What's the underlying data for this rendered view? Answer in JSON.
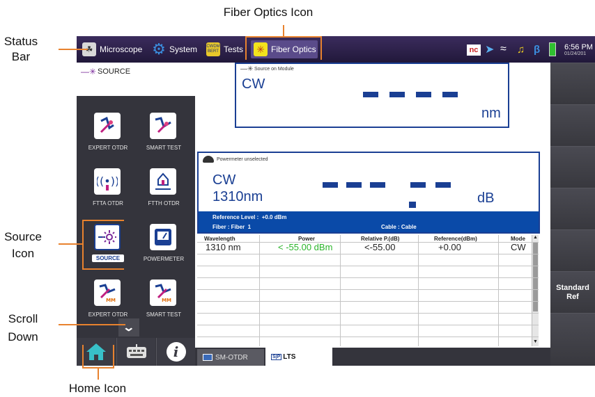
{
  "annotations": {
    "fiber_optics_icon": "Fiber Optics Icon",
    "status_bar_line1": "Status",
    "status_bar_line2": "Bar",
    "source_icon_line1": "Source",
    "source_icon_line2": "Icon",
    "scroll_down_line1": "Scroll",
    "scroll_down_line2": "Down",
    "home_icon": "Home Icon"
  },
  "statusbar": {
    "tabs": [
      {
        "label": "Microscope",
        "icon": "microscope-icon",
        "color": "#cfcfcf"
      },
      {
        "label": "System",
        "icon": "gear-icon",
        "color": "#3b8fe0"
      },
      {
        "label": "Tests",
        "icon": "tests-icon",
        "color": "#e0c52a",
        "badge": "CWDM\nBERT"
      },
      {
        "label": "Fiber Optics",
        "icon": "fiber-optics-icon",
        "color": "#f0e020"
      }
    ],
    "time": "6:56 PM",
    "date": "01/24/201",
    "nc_label": "nc"
  },
  "left": {
    "source_title": "SOURCE",
    "apps": [
      {
        "label": "EXPERT OTDR",
        "icon": "expert-otdr-icon"
      },
      {
        "label": "SMART TEST",
        "icon": "smart-test-icon"
      },
      {
        "label": "FTTA OTDR",
        "icon": "ftta-otdr-icon"
      },
      {
        "label": "FTTH OTDR",
        "icon": "ftth-otdr-icon"
      },
      {
        "label": "SOURCE",
        "icon": "source-icon"
      },
      {
        "label": "POWERMETER",
        "icon": "powermeter-icon"
      },
      {
        "label": "EXPERT OTDR",
        "icon": "expert-otdr-mm-icon"
      },
      {
        "label": "SMART TEST",
        "icon": "smart-test-mm-icon"
      }
    ],
    "mm_badge": "MM"
  },
  "source_panel": {
    "title": "Source on Module",
    "mode": "CW",
    "unit": "nm"
  },
  "powermeter_panel": {
    "title": "Powermeter unselected",
    "mode": "CW",
    "wavelength": "1310nm",
    "unit": "dB",
    "reference_level": "Reference Level :  +0.0 dBm",
    "fiber": "Fiber : Fiber  1",
    "cable": "Cable : Cable"
  },
  "table": {
    "headers": [
      "Wavelength",
      "Power",
      "Relative P.(dB)",
      "Reference(dBm)",
      "Mode"
    ],
    "row": [
      "1310 nm",
      "< -55.00 dBm",
      "<-55.00",
      "+0.00",
      "CW"
    ]
  },
  "bottom_tabs": {
    "sm_otdr": "SM-OTDR",
    "lts": "LTS",
    "lts_icon_text": "S|P"
  },
  "right_panel": {
    "standard_ref": "Standard\nRef"
  },
  "colors": {
    "annotation": "#e8822e",
    "blue_bar": "#0a4aa8",
    "power_green": "#2bb52b",
    "dark_blue": "#1a3f93"
  }
}
